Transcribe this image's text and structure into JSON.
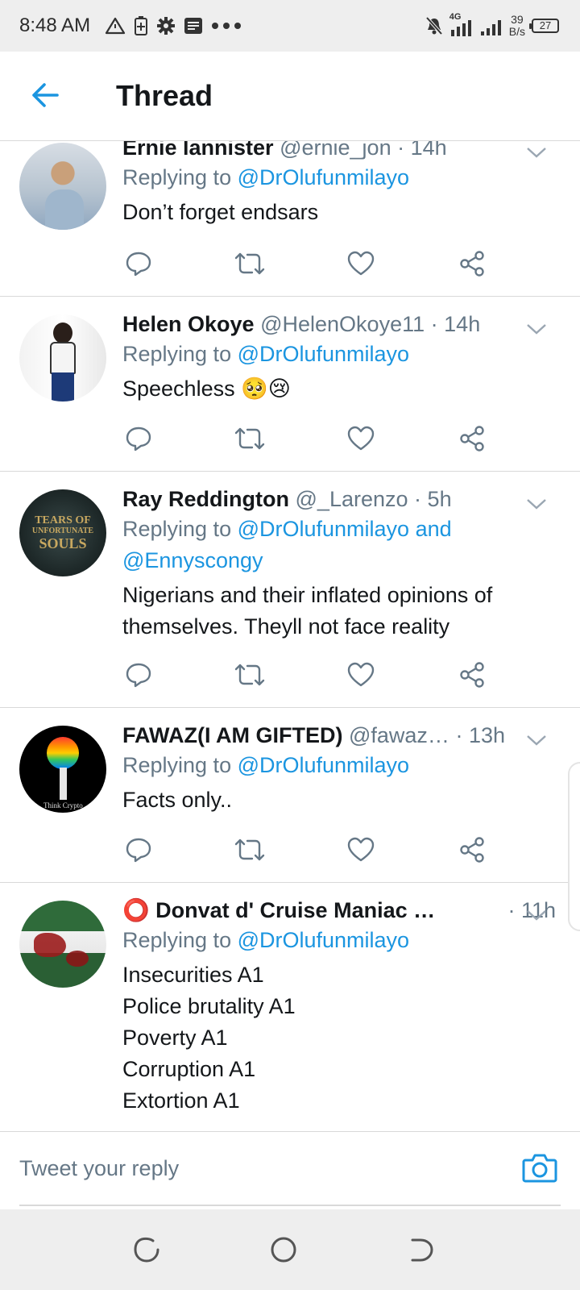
{
  "status_bar": {
    "time": "8:48 AM",
    "network": "4G",
    "speed_value": "39",
    "speed_unit": "B/s",
    "battery": "27"
  },
  "header": {
    "title": "Thread",
    "back_icon": "arrow-left-icon"
  },
  "colors": {
    "accent": "#1b95e0",
    "secondary_text": "#657786",
    "primary_text": "#14171a",
    "divider": "#d9d9d9",
    "system_bar": "#eeeeee"
  },
  "tweets": [
    {
      "name": "Ernie lannister",
      "handle": "@ernie_jon",
      "dot": "·",
      "time": "14h",
      "replying_prefix": "Replying to",
      "mentions": "@DrOlufunmilayo",
      "lines": [
        "Don’t forget endsars"
      ]
    },
    {
      "name": "Helen Okoye",
      "handle": "@HelenOkoye11",
      "dot": "·",
      "time": "14h",
      "replying_prefix": "Replying to",
      "mentions": "@DrOlufunmilayo",
      "lines": [
        "Speechless 🥺😢"
      ]
    },
    {
      "name": "Ray Reddington",
      "handle": "@_Larenzo",
      "dot": "·",
      "time": "5h",
      "replying_prefix": "Replying to",
      "mentions": "@DrOlufunmilayo and",
      "mentions_line2": "@Ennyscongy",
      "lines": [
        "Nigerians and their inflated opinions of",
        "themselves. Theyll not face reality"
      ],
      "avatar_text": [
        "TEARS OF",
        "UNFORTUNATE",
        "SOULS"
      ]
    },
    {
      "name": "FAWAZ(I AM GIFTED)",
      "handle": "@fawaz…",
      "dot": "·",
      "time": "13h",
      "replying_prefix": "Replying to",
      "mentions": "@DrOlufunmilayo",
      "lines": [
        "Facts only.."
      ],
      "avatar_text": [
        "Think Crypto"
      ]
    },
    {
      "name": "⭕ Donvat d' Cruise Maniac …",
      "handle": "",
      "dot": "·",
      "time": "11h",
      "replying_prefix": "Replying to",
      "mentions": "@DrOlufunmilayo",
      "lines": [
        "Insecurities A1",
        "Police brutality A1",
        "Poverty A1",
        "Corruption A1",
        "Extortion A1"
      ]
    }
  ],
  "action_icons": [
    "reply-icon",
    "retweet-icon",
    "like-icon",
    "share-icon"
  ],
  "reply_bar": {
    "placeholder": "Tweet your reply",
    "camera_icon": "camera-icon"
  },
  "nav_bar": {
    "icons": [
      "recent-apps-icon",
      "home-icon",
      "back-icon"
    ]
  }
}
